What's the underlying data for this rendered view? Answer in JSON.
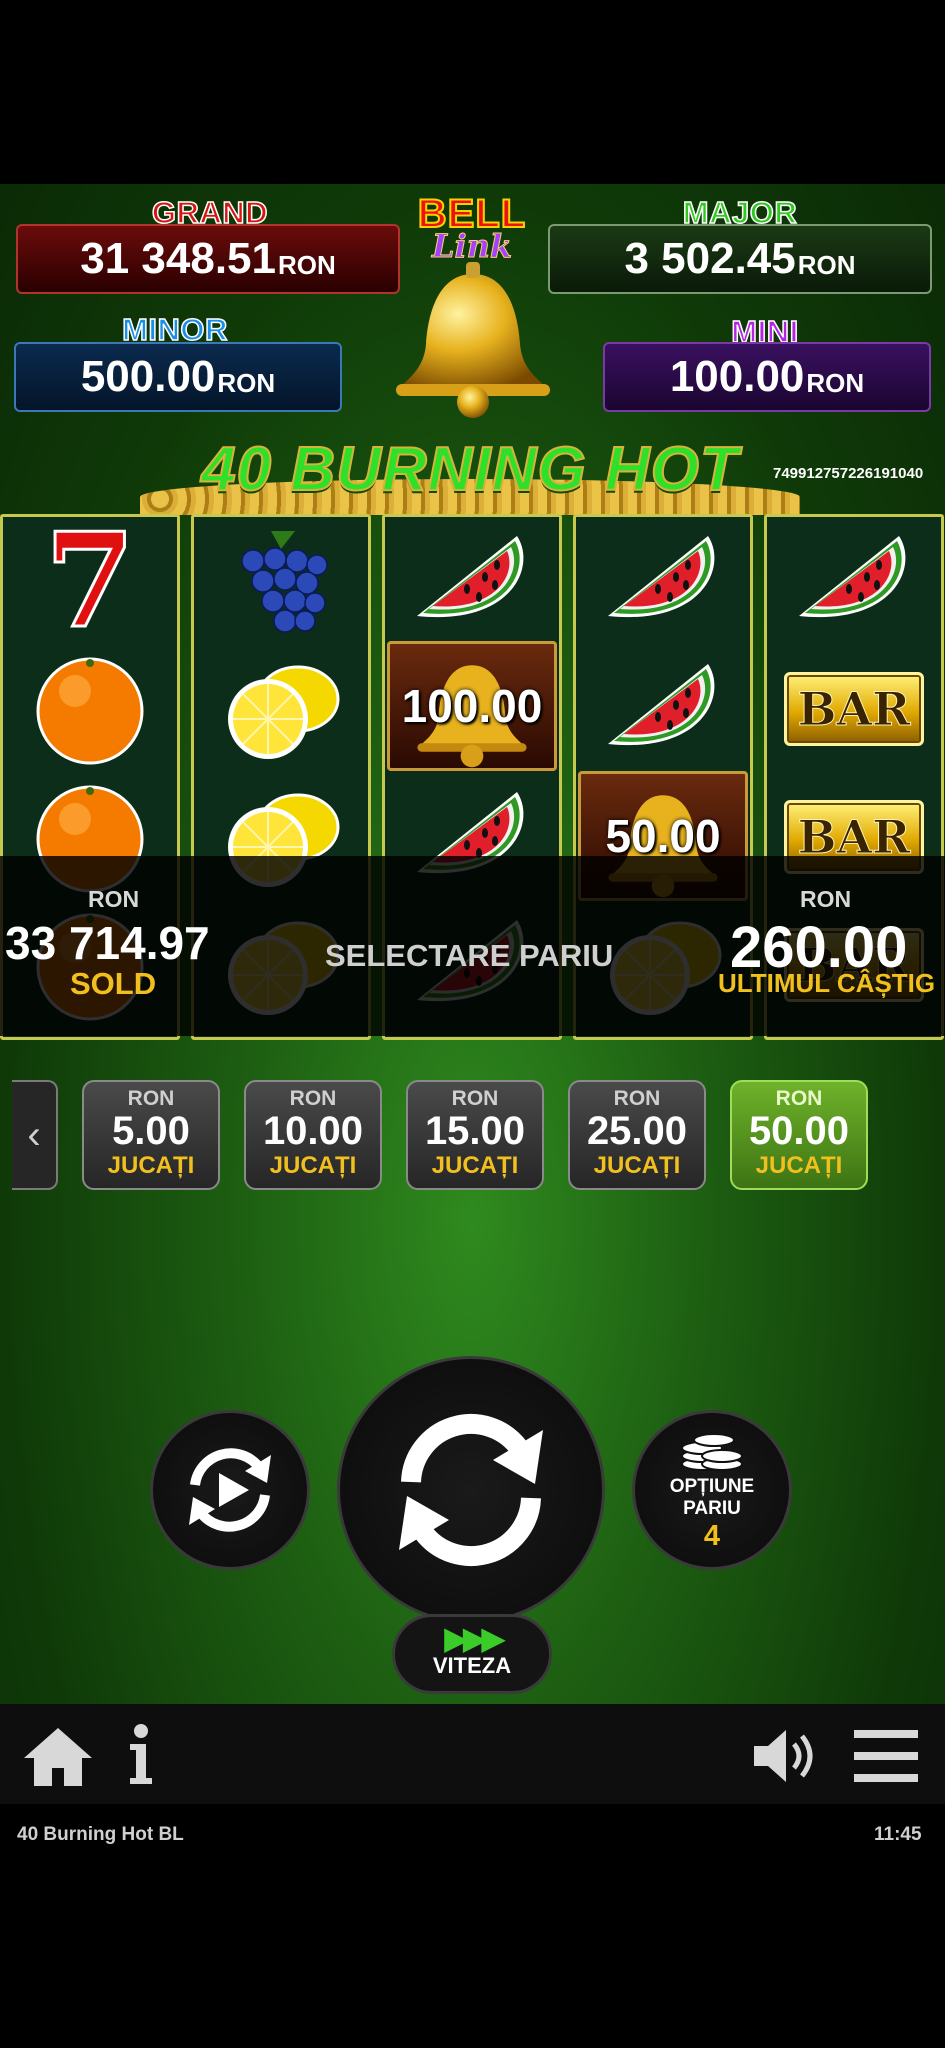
{
  "jackpots": {
    "grand": {
      "title": "GRAND",
      "value": "31 348.51",
      "currency": "RON"
    },
    "major": {
      "title": "MAJOR",
      "value": "3 502.45",
      "currency": "RON"
    },
    "minor": {
      "title": "MINOR",
      "value": "500.00",
      "currency": "RON"
    },
    "mini": {
      "title": "MINI",
      "value": "100.00",
      "currency": "RON"
    }
  },
  "logo": {
    "line1": "BELL",
    "line2": "Link"
  },
  "game_title": "40 BURNING HOT",
  "session_id": "7499127572261910​40",
  "reels": [
    [
      "seven",
      "orange",
      "orange",
      "orange"
    ],
    [
      "grapes",
      "lemon",
      "lemon",
      "lemon"
    ],
    [
      "watermelon",
      "bell",
      "watermelon",
      "watermelon"
    ],
    [
      "watermelon",
      "watermelon",
      "bell",
      "lemon"
    ],
    [
      "watermelon",
      "bar",
      "bar",
      "bar"
    ]
  ],
  "bell_values": {
    "reel3": "100.00",
    "reel4": "50.00"
  },
  "bar_label": "BAR",
  "balance": {
    "currency": "RON",
    "value": "33 714.97",
    "label": "SOLD"
  },
  "select_bet_label": "SELECTARE PARIU",
  "last_win": {
    "currency": "RON",
    "value": "260.00",
    "label": "ULTIMUL CÂȘTIG"
  },
  "bets": [
    {
      "currency": "RON",
      "value": "5.00",
      "label": "JUCAȚI",
      "selected": false
    },
    {
      "currency": "RON",
      "value": "10.00",
      "label": "JUCAȚI",
      "selected": false
    },
    {
      "currency": "RON",
      "value": "15.00",
      "label": "JUCAȚI",
      "selected": false
    },
    {
      "currency": "RON",
      "value": "25.00",
      "label": "JUCAȚI",
      "selected": false
    },
    {
      "currency": "RON",
      "value": "50.00",
      "label": "JUCAȚI",
      "selected": true
    }
  ],
  "bet_option": {
    "line1": "OPȚIUNE",
    "line2": "PARIU",
    "value": "4"
  },
  "speed_label": "VITEZA",
  "status_bar": {
    "app_name": "40 Burning Hot BL",
    "time": "11:45"
  },
  "icons": [
    "home-icon",
    "info-icon",
    "volume-icon",
    "menu-icon",
    "autoplay-icon",
    "spin-icon",
    "coins-icon",
    "chevron-left-icon"
  ],
  "colors": {
    "grand": "#d51510",
    "major": "#2fc81e",
    "minor": "#1a8fe8",
    "mini": "#b524e4",
    "accent_gold": "#f2c01e",
    "selected_bet": "#5a9a22"
  }
}
